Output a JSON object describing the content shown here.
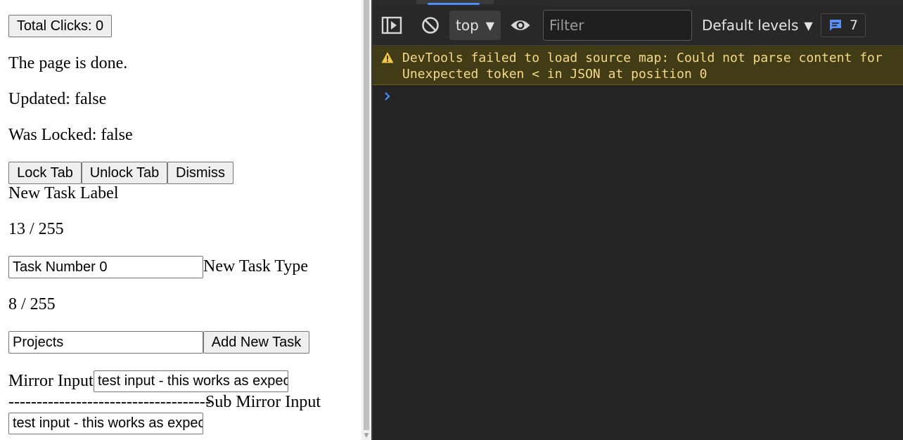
{
  "page": {
    "total_clicks_button": "Total Clicks: 0",
    "status_text": "The page is done.",
    "updated_text": "Updated: false",
    "locked_text": "Was Locked: false",
    "lock_tab_button": "Lock Tab",
    "unlock_tab_button": "Unlock Tab",
    "dismiss_button": "Dismiss",
    "task_label_heading": "New Task Label",
    "task_label_counter": "13 / 255",
    "task_label_value": "Task Number 0",
    "task_type_heading": "New Task Type",
    "task_type_counter": "8 / 255",
    "task_type_value": "Projects",
    "add_task_button": "Add New Task",
    "mirror_label": "Mirror Input",
    "mirror_value": "test input - this works as expected",
    "separator_text": "------------------------------------",
    "sub_mirror_label": "Sub Mirror Input",
    "sub_mirror_value": "test input - this works as expected"
  },
  "devtools": {
    "context": "top",
    "filter_placeholder": "Filter",
    "levels": "Default levels",
    "issues_count": "7",
    "warning_line1": "DevTools failed to load source map: Could not parse content for",
    "warning_line2": "Unexpected token < in JSON at position 0",
    "colors": {
      "background": "#242424",
      "toolbar": "#282828",
      "warning_bg": "#413c16",
      "warning_text": "#f5d98a",
      "accent": "#4b8df8"
    },
    "icons": [
      "sidebar-toggle-icon",
      "clear-console-icon",
      "eye-icon",
      "issues-icon",
      "warning-icon",
      "prompt-chevron-icon"
    ]
  }
}
